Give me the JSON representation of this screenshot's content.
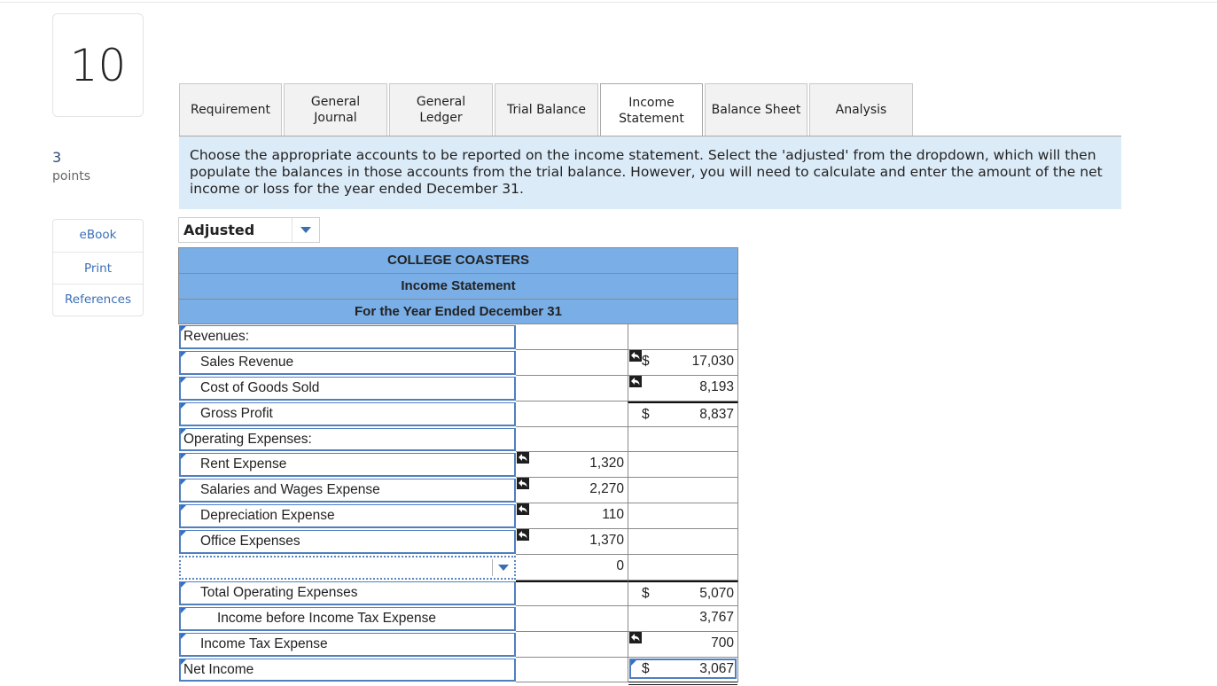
{
  "question": {
    "number": "10",
    "points_value": "3",
    "points_label": "points"
  },
  "side_links": [
    {
      "label": "eBook"
    },
    {
      "label": "Print"
    },
    {
      "label": "References"
    }
  ],
  "tabs": [
    {
      "label": "Requirement",
      "active": false
    },
    {
      "label": "General\nJournal",
      "active": false
    },
    {
      "label": "General\nLedger",
      "active": false
    },
    {
      "label": "Trial Balance",
      "active": false
    },
    {
      "label": "Income\nStatement",
      "active": true
    },
    {
      "label": "Balance Sheet",
      "active": false
    },
    {
      "label": "Analysis",
      "active": false
    }
  ],
  "instructions": "Choose the appropriate accounts to be reported on the income statement. Select the 'adjusted' from the dropdown, which will then populate the balances in those accounts from the trial balance. However, you will need to calculate and enter the amount of the net income or loss for the year ended December 31.",
  "balance_select": {
    "value": "Adjusted",
    "icon": "chevron-down-icon"
  },
  "statement": {
    "company": "COLLEGE COASTERS",
    "title": "Income Statement",
    "period": "For the Year Ended December 31",
    "rows": [
      {
        "account": "Revenues:",
        "indent": 0,
        "col2": "",
        "col3_dollar": "",
        "col3": "",
        "undo2": false,
        "undo3": false
      },
      {
        "account": "Sales Revenue",
        "indent": 1,
        "col2": "",
        "col3_dollar": "$",
        "col3": "17,030",
        "undo2": false,
        "undo3": true
      },
      {
        "account": "Cost of Goods Sold",
        "indent": 1,
        "col2": "",
        "col3_dollar": "",
        "col3": "8,193",
        "undo2": false,
        "undo3": true
      },
      {
        "account": "Gross Profit",
        "indent": 1,
        "col2": "",
        "col3_dollar": "$",
        "col3": "8,837",
        "undo2": false,
        "undo3": false
      },
      {
        "account": "Operating Expenses:",
        "indent": 0,
        "col2": "",
        "col3_dollar": "",
        "col3": "",
        "undo2": false,
        "undo3": false
      },
      {
        "account": "Rent Expense",
        "indent": 1,
        "col2": "1,320",
        "col3_dollar": "",
        "col3": "",
        "undo2": true,
        "undo3": false
      },
      {
        "account": "Salaries and Wages Expense",
        "indent": 1,
        "col2": "2,270",
        "col3_dollar": "",
        "col3": "",
        "undo2": true,
        "undo3": false
      },
      {
        "account": "Depreciation Expense",
        "indent": 1,
        "col2": "110",
        "col3_dollar": "",
        "col3": "",
        "undo2": true,
        "undo3": false
      },
      {
        "account": "Office Expenses",
        "indent": 1,
        "col2": "1,370",
        "col3_dollar": "",
        "col3": "",
        "undo2": true,
        "undo3": false
      },
      {
        "account": "",
        "indent": 0,
        "col2": "0",
        "col3_dollar": "",
        "col3": "",
        "undo2": false,
        "undo3": false,
        "dropdown": true
      },
      {
        "account": "Total Operating Expenses",
        "indent": 1,
        "col2": "",
        "col3_dollar": "$",
        "col3": "5,070",
        "undo2": false,
        "undo3": false
      },
      {
        "account": "Income before Income Tax Expense",
        "indent": 2,
        "col2": "",
        "col3_dollar": "",
        "col3": "3,767",
        "undo2": false,
        "undo3": false
      },
      {
        "account": "Income Tax Expense",
        "indent": 1,
        "col2": "",
        "col3_dollar": "",
        "col3": "700",
        "undo2": false,
        "undo3": true
      },
      {
        "account": "Net Income",
        "indent": 0,
        "col2": "",
        "col3_dollar": "$",
        "col3": "3,067",
        "undo2": false,
        "undo3": false,
        "net": true
      }
    ]
  }
}
